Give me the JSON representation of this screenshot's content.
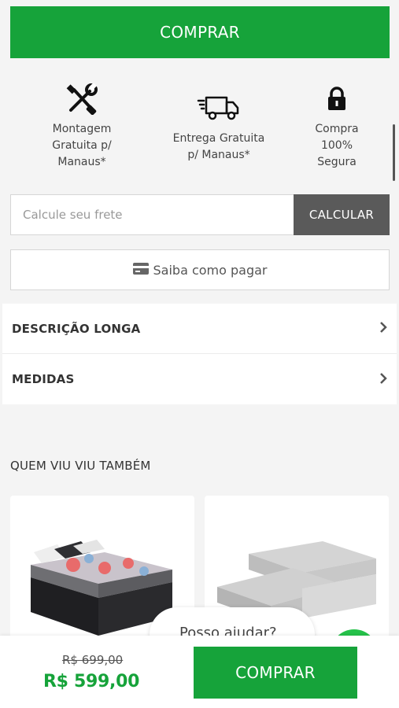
{
  "top_buy": {
    "label": "COMPRAR"
  },
  "features": [
    {
      "icon": "tools-icon",
      "label": "Montagem\nGratuita p/\nManaus*"
    },
    {
      "icon": "truck-icon",
      "label": "Entrega Gratuita\np/ Manaus*"
    },
    {
      "icon": "lock-icon",
      "label": "Compra\n100%\nSegura"
    }
  ],
  "freight": {
    "placeholder": "Calcule seu frete",
    "button_label": "CALCULAR"
  },
  "payment": {
    "label": "Saiba como pagar",
    "icon": "credit-card-icon"
  },
  "accordion": [
    {
      "title": "DESCRIÇÃO LONGA"
    },
    {
      "title": "MEDIDAS"
    }
  ],
  "related": {
    "title": "QUEM VIU VIU TAMBÉM"
  },
  "chat": {
    "text": "Posso ajudar?"
  },
  "bottom_bar": {
    "old_price": "R$ 699,00",
    "price": "R$ 599,00",
    "buy_label": "COMPRAR"
  },
  "colors": {
    "accent": "#16a33a",
    "dark_button": "#5a5a5a",
    "background": "#f4f4f4"
  }
}
